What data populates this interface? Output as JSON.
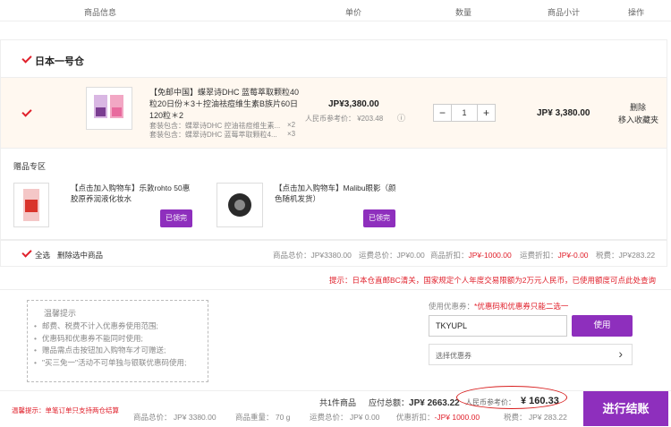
{
  "header": {
    "product_info": "商品信息",
    "unit_price": "单价",
    "quantity": "数量",
    "subtotal": "商品小计",
    "operation": "操作"
  },
  "warehouse": {
    "name": "日本一号仓"
  },
  "item": {
    "title": "【免邮中国】蝶翠诗DHC 蓝莓萃取颗粒40粒20日份＊3＋控油祛痘维生素B族片60日 120粒＊2",
    "bundle_1": "套装包含：蝶翠诗DHC 控油祛痘维生素...",
    "bundle_1_qty": "×2",
    "bundle_2": "套装包含：蝶翠诗DHC 蓝莓萃取颗粒4...",
    "bundle_2_qty": "×3",
    "price": "JP¥3,380.00",
    "rmb_ref": "人民币参考价： ¥203.48",
    "info_icon": "ⓘ",
    "qty_minus": "−",
    "qty_value": "1",
    "qty_plus": "+",
    "subtotal": "JP¥ 3,380.00",
    "delete": "删除",
    "move_fav": "移入收藏夹"
  },
  "gifts": {
    "title": "赠品专区",
    "items": [
      {
        "name": "【点击加入购物车】乐敦rohto 50惠 胶原养润液化妆水",
        "button": "已领完"
      },
      {
        "name": "【点击加入购物车】Malibu眼影（颜色随机发货）",
        "button": "已领完"
      }
    ]
  },
  "select_bar": {
    "select_all": "全选",
    "delete_selected": "删除选中商品",
    "total": "商品总价：JP¥3380.00",
    "shipping": "运费总价：JP¥0.00",
    "discount_label": "商品折扣：",
    "discount_value": "JP¥-1000.00",
    "ship_discount_label": "运费折扣：",
    "ship_discount_value": "JP¥-0.00",
    "tax": "税费：JP¥283.22"
  },
  "notice": "提示：日本仓直邮BC清关，国家规定个人年度交易限额为2万元人民币，已使用额度可点此处查询",
  "tips": {
    "title": "温馨提示",
    "items": [
      "邮费、税费不计入优惠券使用范围;",
      "优惠码和优惠券不能同时使用;",
      "赠品需点击按钮加入购物车才可赠送;",
      "\"买三免一\"活动不可单独与银联优惠码使用;"
    ]
  },
  "coupon": {
    "label": "使用优惠券：",
    "hint": "*优惠码和优惠券只能二选一",
    "code_value": "TKYUPL",
    "use_button": "使用",
    "select_placeholder": "选择优惠券",
    "chevron": "›"
  },
  "summary": {
    "count": "共1件商品",
    "total_label": "应付总额：",
    "total_value": "JP¥ 2663.22",
    "rmb_label": "人民币参考价：",
    "rmb_value": "¥ 160.33",
    "warning": "温馨提示：单笔订单只支持两仓结算",
    "goods_total": "商品总价： JP¥ 3380.00",
    "weight": "商品重量： 70 g",
    "shipping": "运费总价： JP¥ 0.00",
    "discount_label": "优惠折扣：",
    "discount_value": "-JP¥ 1000.00",
    "tax": "税费： JP¥ 283.22",
    "checkout": "进行结账"
  }
}
